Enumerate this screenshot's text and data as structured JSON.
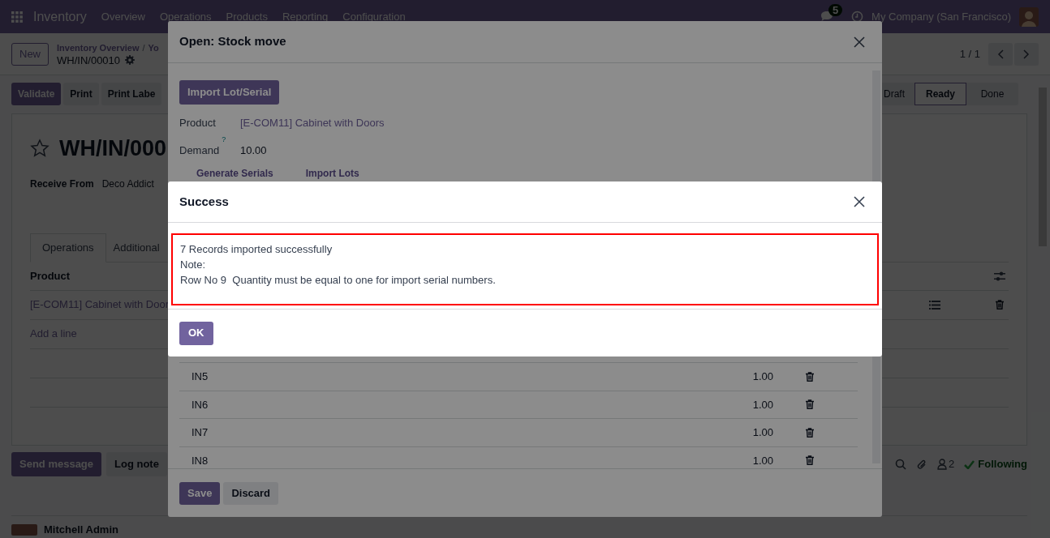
{
  "navbar": {
    "app": "Inventory",
    "menus": [
      "Overview",
      "Operations",
      "Products",
      "Reporting",
      "Configuration"
    ],
    "message_count": "5",
    "company": "My Company (San Francisco)"
  },
  "control_panel": {
    "new_button": "New",
    "breadcrumb": [
      "Inventory Overview",
      "Yo"
    ],
    "breadcrumb_separator": "/",
    "record": "WH/IN/00010",
    "pager": "1 / 1"
  },
  "action_buttons": [
    {
      "label": "Print Labe",
      "kind": "secondary"
    }
  ],
  "primary_action": "Validate",
  "secondary_action": "Print",
  "status_steps": [
    {
      "label": "Draft",
      "selected": false
    },
    {
      "label": "Ready",
      "selected": true
    },
    {
      "label": "Done",
      "selected": false
    }
  ],
  "form": {
    "title": "WH/IN/000",
    "fields": [
      {
        "label": "Receive From",
        "value": "Deco Addict"
      }
    ],
    "tabs": [
      {
        "label": "Operations",
        "selected": true
      },
      {
        "label": "Additional",
        "selected": false
      }
    ],
    "table": {
      "columns": [
        "Product"
      ],
      "rows": [
        [
          "[E-COM11] Cabinet with Door"
        ]
      ],
      "add_line": "Add a line"
    }
  },
  "chatter": {
    "buttons": [
      {
        "label": "Send message",
        "kind": "primary"
      },
      {
        "label": "Log note",
        "kind": "secondary"
      }
    ],
    "followers": "2",
    "following": "Following",
    "author": "Mitchell Admin"
  },
  "stock_move_dialog": {
    "title": "Open: Stock move",
    "import_button": "Import Lot/Serial",
    "fields": [
      {
        "label": "Product",
        "value": "[E-COM11] Cabinet with Doors",
        "kind": "link"
      },
      {
        "label": "Demand",
        "help": "?",
        "value": "10.00",
        "kind": "text"
      }
    ],
    "tabs": [
      "Generate Serials",
      "Import Lots"
    ],
    "lines": [
      {
        "lot": "IN5",
        "quantity": "1.00"
      },
      {
        "lot": "IN6",
        "quantity": "1.00"
      },
      {
        "lot": "IN7",
        "quantity": "1.00"
      },
      {
        "lot": "IN8",
        "quantity": "1.00"
      }
    ],
    "buttons": [
      {
        "label": "Save",
        "kind": "primary"
      },
      {
        "label": "Discard",
        "kind": "secondary"
      }
    ]
  },
  "success_dialog": {
    "title": "Success",
    "message_lines": [
      "7 Records imported successfully",
      "Note:",
      "Row No 9  Quantity must be equal to one for import serial numbers."
    ],
    "button": "OK"
  }
}
